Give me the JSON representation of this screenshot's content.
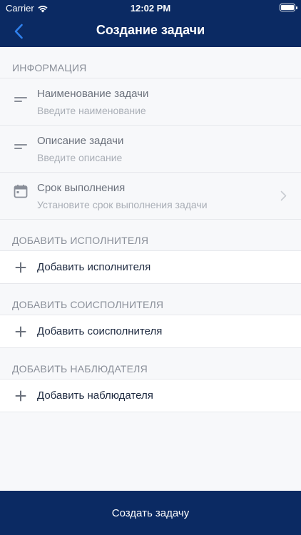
{
  "status_bar": {
    "carrier": "Carrier",
    "time": "12:02 PM"
  },
  "nav": {
    "title": "Создание задачи"
  },
  "sections": {
    "info": {
      "header": "ИНФОРМАЦИЯ",
      "fields": [
        {
          "label": "Наименование задачи",
          "placeholder": "Введите наименование",
          "icon": "text-lines-icon"
        },
        {
          "label": "Описание задачи",
          "placeholder": "Введите описание",
          "icon": "text-lines-icon"
        },
        {
          "label": "Срок выполнения",
          "placeholder": "Установите срок выполнения задачи",
          "icon": "calendar-icon"
        }
      ]
    },
    "executor": {
      "header": "ДОБАВИТЬ ИСПОЛНИТЕЛЯ",
      "add_label": "Добавить исполнителя"
    },
    "co_executor": {
      "header": "ДОБАВИТЬ СОИСПОЛНИТЕЛЯ",
      "add_label": "Добавить соисполнителя"
    },
    "observer": {
      "header": "ДОБАВИТЬ НАБЛЮДАТЕЛЯ",
      "add_label": "Добавить наблюдателя"
    }
  },
  "bottom_button": {
    "label": "Создать задачу"
  },
  "colors": {
    "brand": "#0b2a63",
    "accent": "#2f80ed",
    "background": "#f7f8fa"
  }
}
